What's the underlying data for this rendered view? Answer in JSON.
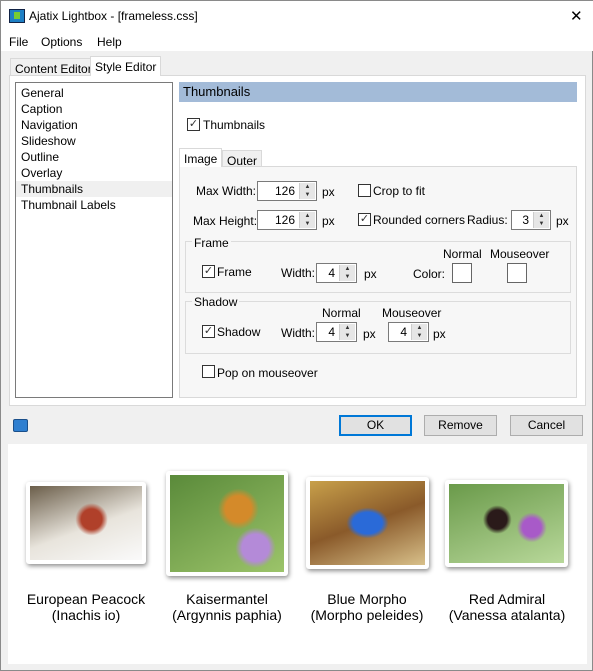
{
  "window": {
    "title": "Ajatix Lightbox - [frameless.css]",
    "close": "✕"
  },
  "menu": [
    "File",
    "Options",
    "Help"
  ],
  "tabs": [
    "Content Editor",
    "Style Editor"
  ],
  "sidebar": [
    "General",
    "Caption",
    "Navigation",
    "Slideshow",
    "Outline",
    "Overlay",
    "Thumbnails",
    "Thumbnail Labels"
  ],
  "section": {
    "title": "Thumbnails",
    "enable_label": "Thumbnails",
    "enable_checked": true
  },
  "inner_tabs": [
    "Image",
    "Outer"
  ],
  "image": {
    "max_width_label": "Max Width:",
    "max_width": "126",
    "max_height_label": "Max Height:",
    "max_height": "126",
    "px": "px",
    "crop_label": "Crop to fit",
    "crop_checked": false,
    "rounded_label": "Rounded corners",
    "rounded_checked": true,
    "radius_label": "Radius:",
    "radius": "3",
    "frame": {
      "legend": "Frame",
      "checkbox": "Frame",
      "checked": true,
      "width_label": "Width:",
      "width": "4",
      "color_label": "Color:",
      "normal": "Normal",
      "mouseover": "Mouseover",
      "normal_color": "#ffffff",
      "mouseover_color": "#ffffff"
    },
    "shadow": {
      "legend": "Shadow",
      "checkbox": "Shadow",
      "checked": true,
      "width_label": "Width:",
      "normal": "Normal",
      "mouseover": "Mouseover",
      "normal_width": "4",
      "mouseover_width": "4"
    },
    "pop_label": "Pop on mouseover",
    "pop_checked": false
  },
  "buttons": {
    "ok": "OK",
    "remove": "Remove",
    "cancel": "Cancel"
  },
  "preview": [
    {
      "name": "European Peacock",
      "latin": "(Inachis io)"
    },
    {
      "name": "Kaisermantel",
      "latin": "(Argynnis paphia)"
    },
    {
      "name": "Blue Morpho",
      "latin": "(Morpho peleides)"
    },
    {
      "name": "Red Admiral",
      "latin": "(Vanessa atalanta)"
    }
  ],
  "colors": {
    "header": "#a3bbd8",
    "accent": "#0078d7"
  }
}
